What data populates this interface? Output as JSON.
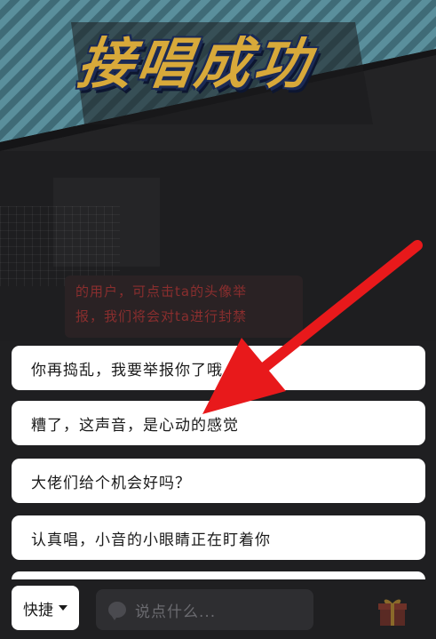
{
  "banner": {
    "title": "接唱成功",
    "stripe_color": "#4d7f8c",
    "title_color": "#d8a93a",
    "outline_color": "#1b2a55"
  },
  "notice": {
    "line1": "的用户，可点击ta的头像举",
    "line2": "报，我们将会对ta进行封禁",
    "color": "#8a2e2e"
  },
  "quick_phrases": [
    "你再捣乱，我要举报你了哦",
    "糟了，这声音，是心动的感觉",
    "大佬们给个机会好吗？",
    "认真唱，小音的小眼睛正在盯着你"
  ],
  "bottom_bar": {
    "quick_label": "快捷",
    "input_placeholder": "说点什么...",
    "gift_icon": "gift-icon",
    "comment_icon": "chat-bubble-icon"
  },
  "annotation": {
    "arrow_color": "#e8191b"
  }
}
